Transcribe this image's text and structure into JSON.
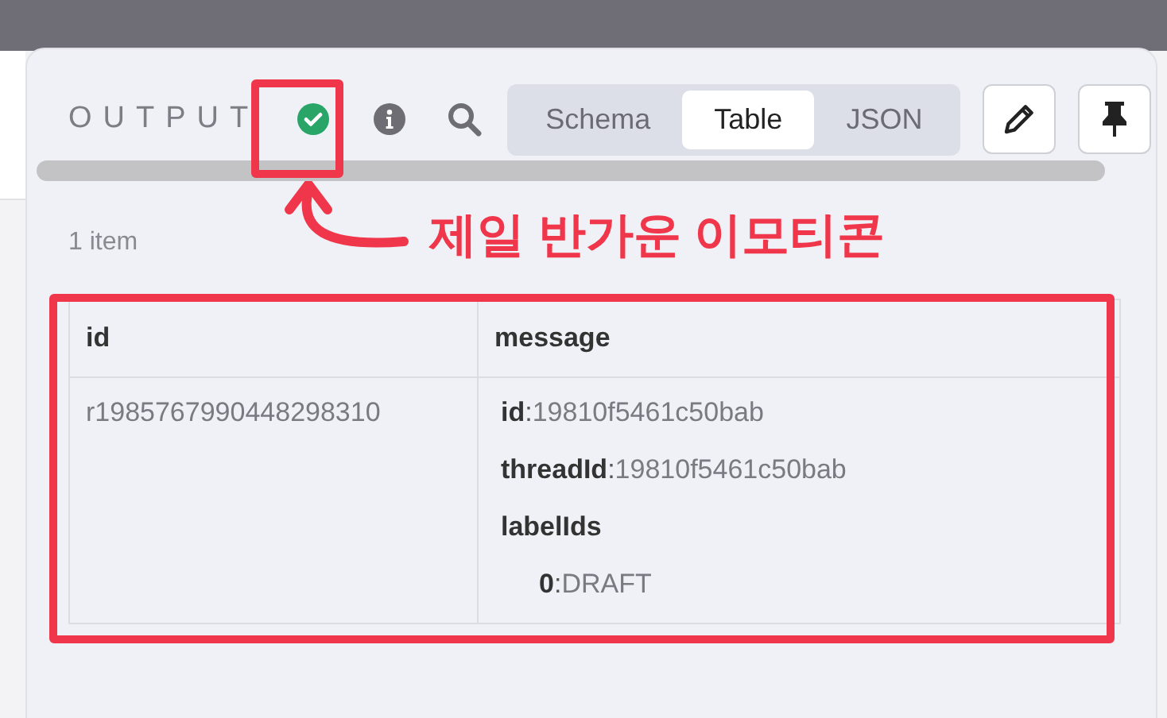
{
  "panel": {
    "title": "OUTPUT",
    "tabs": [
      {
        "label": "Schema",
        "selected": false
      },
      {
        "label": "Table",
        "selected": true
      },
      {
        "label": "JSON",
        "selected": false
      }
    ],
    "item_count": "1 item",
    "table": {
      "columns": [
        "id",
        "message"
      ],
      "rows": [
        {
          "id": "r1985767990448298310",
          "message": [
            {
              "key": "id",
              "separator": ":",
              "value": "19810f5461c50bab"
            },
            {
              "key": "threadId",
              "separator": ":",
              "value": "19810f5461c50bab"
            },
            {
              "key": "labelIds",
              "children": [
                {
                  "key": "0",
                  "separator": ":",
                  "value": "DRAFT"
                }
              ]
            }
          ]
        }
      ]
    }
  },
  "annotation": {
    "caption": "제일 반가운 이모티콘"
  }
}
